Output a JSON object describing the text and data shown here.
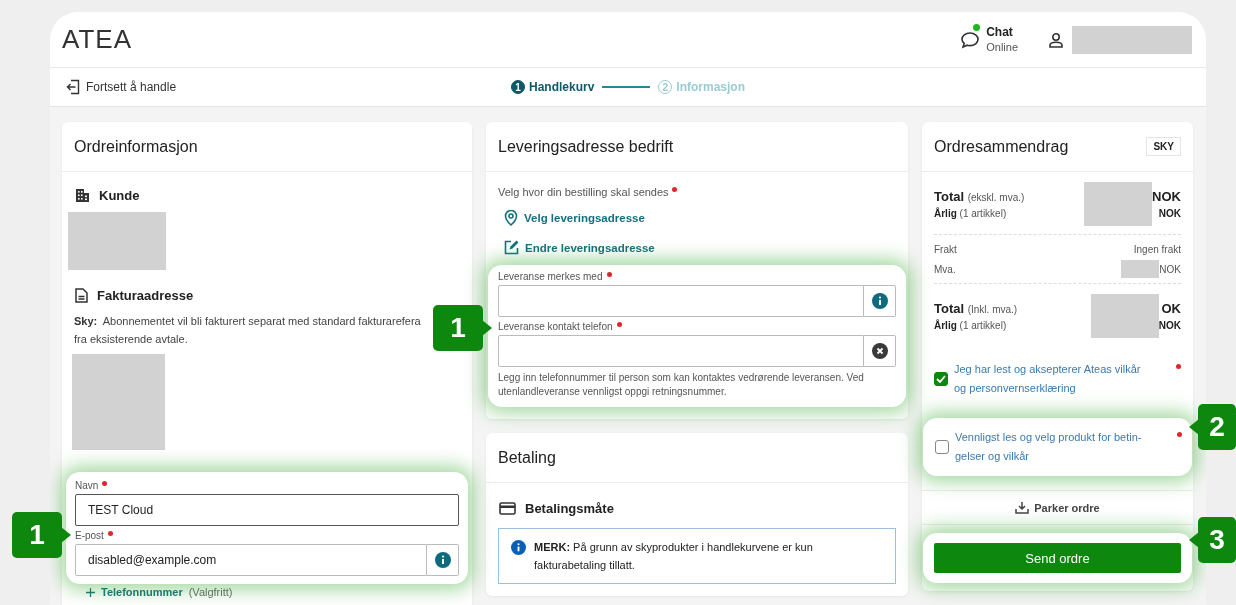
{
  "header": {
    "logo": "ATEA",
    "chat": {
      "label": "Chat",
      "status": "Online",
      "online": true
    }
  },
  "nav": {
    "back_link": "Fortsett å handle",
    "steps": [
      {
        "number": "1",
        "label": "Handlekurv",
        "selected": true
      },
      {
        "number": "2",
        "label": "Informasjon",
        "selected": false
      }
    ]
  },
  "order_info": {
    "title": "Ordreinformasjon",
    "customer_heading": "Kunde",
    "billing": {
      "heading": "Fakturaadresse",
      "note_label": "Sky:",
      "note_lines": [
        "Abonnementet vil bli fakturert separat med standard fakturarefera",
        "fra eksisterende avtale."
      ]
    },
    "contact": {
      "highlighted": true,
      "fields": [
        {
          "label": "Navn",
          "required": true,
          "value": "TEST Cloud",
          "focused": true,
          "kind": "plain"
        },
        {
          "label": "E-post",
          "required": true,
          "value": "disabled@example.com",
          "focused": false,
          "kind": "info"
        }
      ]
    },
    "add_phone": {
      "label": "Telefonnummer",
      "hint": "(Valgfritt)"
    }
  },
  "delivery": {
    "title": "Leveringsadresse bedrift",
    "prompt": "Velg hvor din bestilling skal sendes",
    "prompt_required": true,
    "links": [
      {
        "kind": "pin",
        "label": "Velg leveringsadresse"
      },
      {
        "kind": "edit",
        "label": "Endre leveringsadresse"
      }
    ],
    "marking": {
      "highlighted": true,
      "fields": [
        {
          "label": "Leveranse merkes med",
          "required": true,
          "focused": false,
          "kind": "info"
        },
        {
          "label": "Leveranse kontakt telefon",
          "required": true,
          "focused": false,
          "kind": "clear"
        }
      ],
      "help": "Legg inn telefonnummer til person som kan kontaktes vedrørende leveransen. Ved utenlandleveranse vennligst oppgi retningsnummer."
    }
  },
  "payment": {
    "title": "Betaling",
    "method_heading": "Betalingsmåte",
    "notice": "**MERK:** På grunn av skyprodukter i handlekurvene er kun fakturabetaling tillatt."
  },
  "summary": {
    "title": "Ordresammendrag",
    "badge": "SKY",
    "totals": [
      {
        "label": "Total",
        "qualifier": "(ekskl. mva.)",
        "currency": "NOK",
        "sub_label": "Årlig",
        "sub_qualifier": "(1 artikkel)",
        "sub_currency": "NOK"
      },
      {
        "label": "Total",
        "qualifier": "(Inkl. mva.)",
        "currency": "OK",
        "sub_label": "Årlig",
        "sub_qualifier": "(1 artikkel)",
        "sub_currency": "NOK"
      }
    ],
    "lines": [
      {
        "label": "Frakt",
        "value": "Ingen frakt",
        "redacted": false
      },
      {
        "label": "Mva.",
        "value": "NOK",
        "redacted": true
      }
    ],
    "terms": [
      {
        "lines": [
          "Jeg har lest og aksepterer Ateas vilkår",
          "og personvernserklæring"
        ],
        "checked": true,
        "required": true,
        "highlighted": false
      },
      {
        "lines": [
          "Vennligst les og velg produkt for betin-",
          "gelser og vilkår"
        ],
        "checked": false,
        "required": true,
        "highlighted": true
      }
    ],
    "park": "Parker ordre",
    "send": {
      "label": "Send ordre",
      "highlighted": true
    }
  },
  "callouts": [
    {
      "number": "1"
    },
    {
      "number": "1"
    },
    {
      "number": "2"
    },
    {
      "number": "3"
    }
  ]
}
